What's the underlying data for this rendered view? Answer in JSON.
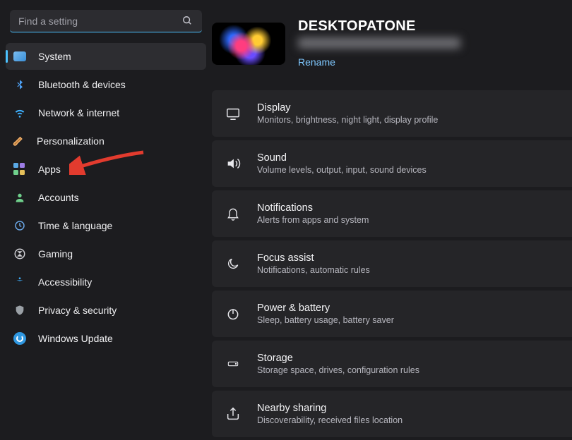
{
  "search": {
    "placeholder": "Find a setting"
  },
  "nav": [
    {
      "label": "System",
      "icon": "system",
      "selected": true
    },
    {
      "label": "Bluetooth & devices",
      "icon": "bluetooth",
      "selected": false
    },
    {
      "label": "Network & internet",
      "icon": "network",
      "selected": false
    },
    {
      "label": "Personalization",
      "icon": "personal",
      "selected": false
    },
    {
      "label": "Apps",
      "icon": "apps",
      "selected": false
    },
    {
      "label": "Accounts",
      "icon": "accounts",
      "selected": false
    },
    {
      "label": "Time & language",
      "icon": "time",
      "selected": false
    },
    {
      "label": "Gaming",
      "icon": "gaming",
      "selected": false
    },
    {
      "label": "Accessibility",
      "icon": "access",
      "selected": false
    },
    {
      "label": "Privacy & security",
      "icon": "privacy",
      "selected": false
    },
    {
      "label": "Windows Update",
      "icon": "update",
      "selected": false
    }
  ],
  "device": {
    "name": "DESKTOPATONE",
    "rename_label": "Rename"
  },
  "system_cards": [
    {
      "icon": "display",
      "title": "Display",
      "sub": "Monitors, brightness, night light, display profile"
    },
    {
      "icon": "sound",
      "title": "Sound",
      "sub": "Volume levels, output, input, sound devices"
    },
    {
      "icon": "notif",
      "title": "Notifications",
      "sub": "Alerts from apps and system"
    },
    {
      "icon": "focus",
      "title": "Focus assist",
      "sub": "Notifications, automatic rules"
    },
    {
      "icon": "power",
      "title": "Power & battery",
      "sub": "Sleep, battery usage, battery saver"
    },
    {
      "icon": "storage",
      "title": "Storage",
      "sub": "Storage space, drives, configuration rules"
    },
    {
      "icon": "nearby",
      "title": "Nearby sharing",
      "sub": "Discoverability, received files location"
    }
  ],
  "annotation": {
    "target_nav_index": 4
  }
}
